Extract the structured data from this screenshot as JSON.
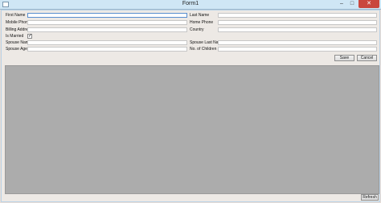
{
  "window": {
    "title": "Form1",
    "minimize": "–",
    "maximize": "□",
    "close": "✕"
  },
  "form": {
    "first_name": {
      "label": "First Name",
      "value": ""
    },
    "mobile_phone": {
      "label": "Mobile Phone",
      "value": ""
    },
    "billing_address": {
      "label": "Billing Address",
      "value": ""
    },
    "is_married": {
      "label": "Is Married",
      "checked": true,
      "check_glyph": "✓"
    },
    "spouse_name": {
      "label": "Spouse Name",
      "value": ""
    },
    "spouse_age": {
      "label": "Spouse Age",
      "value": ""
    },
    "last_name": {
      "label": "Last Name",
      "value": ""
    },
    "home_phone": {
      "label": "Home Phone",
      "value": ""
    },
    "country": {
      "label": "Country",
      "value": ""
    },
    "spouse_last_name": {
      "label": "Spouse Last Name",
      "value": ""
    },
    "no_of_children": {
      "label": "No. of Children",
      "value": ""
    }
  },
  "buttons": {
    "save": "Save",
    "cancel": "Cancel",
    "refresh": "Refresh"
  }
}
